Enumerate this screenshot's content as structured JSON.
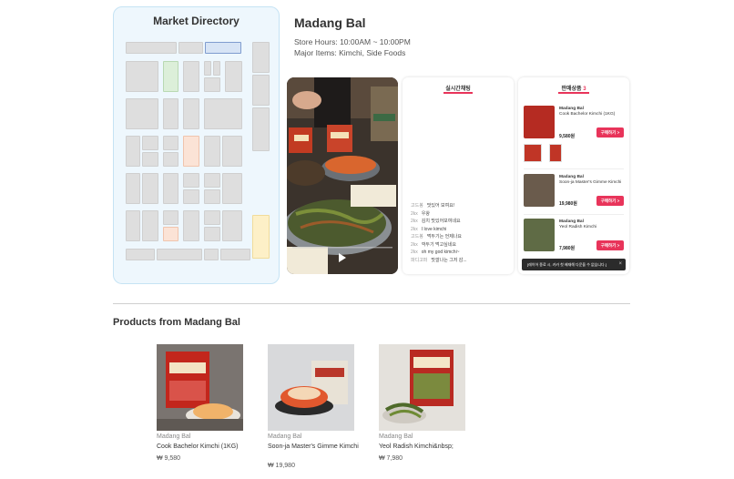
{
  "directory": {
    "title": "Market Directory"
  },
  "store": {
    "name": "Madang Bal",
    "hours": "Store Hours: 10:00AM ~ 10:00PM",
    "items": "Major Items: Kimchi, Side Foods"
  },
  "chat": {
    "title": "실시간채팅",
    "messages": [
      {
        "user": "고드봉",
        "text": "맛있어 보여요!"
      },
      {
        "user": "2kx",
        "text": "우왕"
      },
      {
        "user": "2kx",
        "text": "김치 맛있어보여네요"
      },
      {
        "user": "2kx",
        "text": "I love kimchi"
      },
      {
        "user": "고드봉",
        "text": "먹두기는 언제나요"
      },
      {
        "user": "2kx",
        "text": "깍두기 먹고싶네요"
      },
      {
        "user": "2kx",
        "text": "oh my god kimchi~"
      },
      {
        "user": "파디고퍼",
        "text": "맛깔나는 그저 감..."
      }
    ]
  },
  "sale": {
    "title": "판매상품",
    "count": "3",
    "items": [
      {
        "brand": "Madang Bal",
        "name": "Cook Bachelor Kimchi (1KG)",
        "price": "9,580원",
        "button": "구매하기 >"
      },
      {
        "brand": "Madang Bal",
        "name": "Soon-ja Master's Gimme Kimchi",
        "price": "19,980원",
        "button": "구매하기 >"
      },
      {
        "brand": "Madang Bal",
        "name": "Yeol Radish Kimchi",
        "price": "7,980원",
        "button": "구매하기 >"
      }
    ],
    "toast": "[레이어 종료 시, 카카 첫 배재해 다운을 수 없습니다.]",
    "toast_close": "×"
  },
  "products": {
    "title": "Products from Madang Bal",
    "items": [
      {
        "store": "Madang Bal",
        "name": "Cook Bachelor Kimchi (1KG)",
        "price": "₩ 9,580"
      },
      {
        "store": "Madang Bal",
        "name": "Soon-ja Master's Gimme Kimchi",
        "price": "₩ 19,980"
      },
      {
        "store": "Madang Bal",
        "name": "Yeol Radish Kimchi&nbsp;",
        "price": "₩ 7,980"
      }
    ]
  },
  "colors": {
    "accent": "#e8345a",
    "directory_bg": "#eef7fd"
  }
}
